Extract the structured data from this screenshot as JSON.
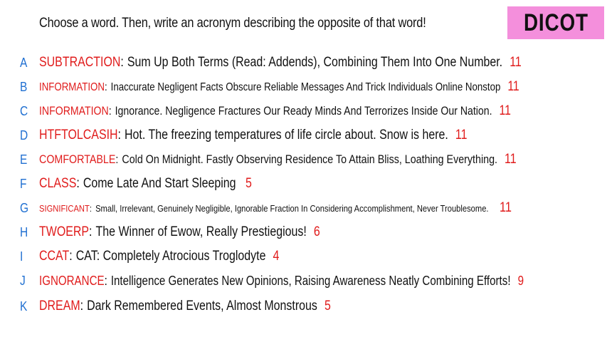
{
  "prompt": "Choose a word. Then, write an acronym describing the opposite of that word!",
  "logo": "DICOT",
  "entries": [
    {
      "letter": "A",
      "word": "SUBTRACTION",
      "acronym": "Sum Up Both Terms (Read: Addends), Combining Them Into One Number.",
      "score": "11"
    },
    {
      "letter": "B",
      "word": "INFORMATION",
      "acronym": "Inaccurate Negligent Facts Obscure Reliable Messages And Trick Individuals Online Nonstop",
      "score": "11"
    },
    {
      "letter": "C",
      "word": "INFORMATION",
      "acronym": "Ignorance. Negligence Fractures Our Ready Minds And Terrorizes Inside Our Nation.",
      "score": "11"
    },
    {
      "letter": "D",
      "word": "HTFTOLCASIH",
      "acronym": "Hot. The freezing temperatures of life circle about. Snow is here.",
      "score": "11"
    },
    {
      "letter": "E",
      "word": "COMFORTABLE",
      "acronym": "Cold On Midnight. Fastly Observing Residence To Attain Bliss, Loathing Everything.",
      "score": "11"
    },
    {
      "letter": "F",
      "word": "CLASS",
      "acronym": "Come Late And Start Sleeping",
      "score": "5"
    },
    {
      "letter": "G",
      "word": "SIGNIFICANT",
      "acronym": "Small, Irrelevant, Genuinely Negligible, Ignorable Fraction In Considering Accomplishment, Never Troublesome.",
      "score": "11"
    },
    {
      "letter": "H",
      "word": "TWOERP",
      "acronym": "The Winner of Ewow, Really Prestiegious!",
      "score": "6"
    },
    {
      "letter": "I",
      "word": "CCAT",
      "acronym": "CAT: Completely Atrocious Troglodyte",
      "score": "4"
    },
    {
      "letter": "J",
      "word": "IGNORANCE",
      "acronym": "Intelligence Generates New Opinions, Raising Awareness Neatly Combining Efforts!",
      "score": "9"
    },
    {
      "letter": "K",
      "word": "DREAM",
      "acronym": "Dark Remembered Events, Almost Monstrous",
      "score": "5"
    }
  ],
  "colors": {
    "letter": "#1f6fd1",
    "word": "#e01b1b",
    "score": "#e01b1b",
    "logo_background": "#f48fdc"
  }
}
